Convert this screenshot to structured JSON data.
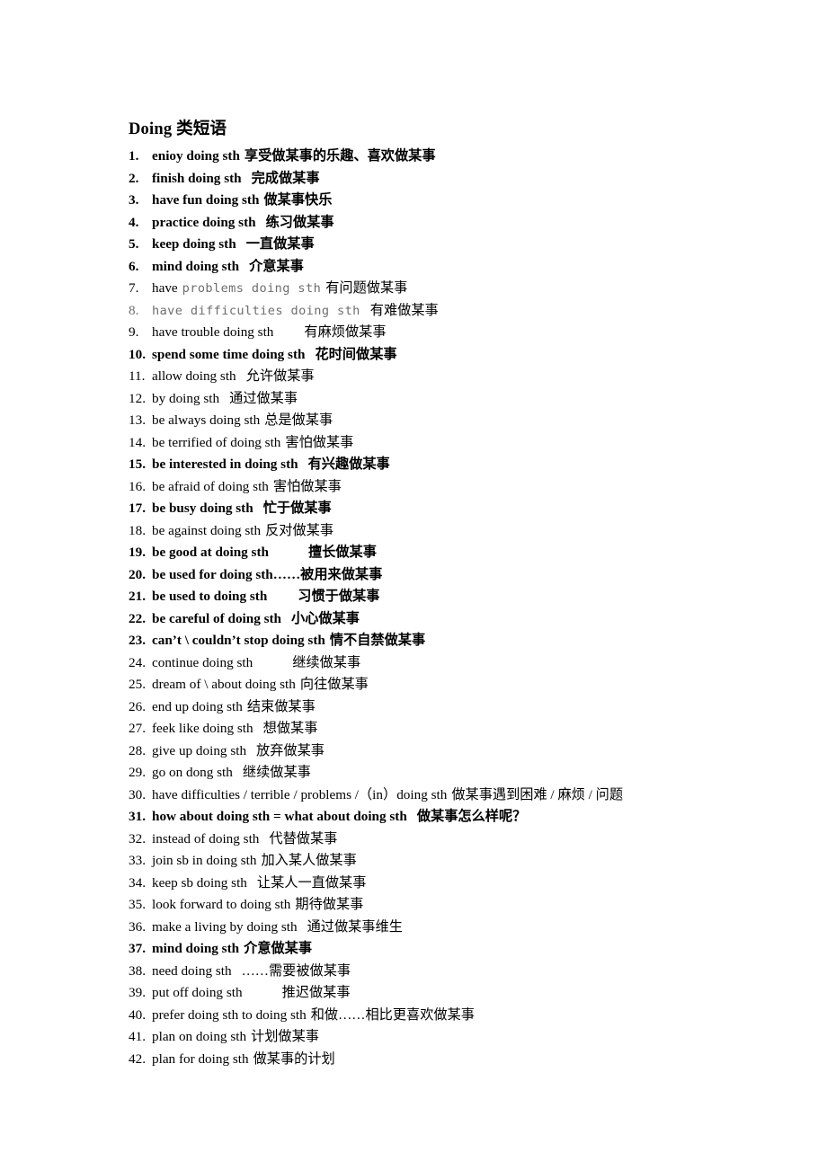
{
  "document": {
    "title": "Doing 类短语",
    "background_color": "#ffffff",
    "text_color": "#000000",
    "muted_text_color": "#6e6e6e"
  },
  "items": [
    {
      "num": "1.",
      "en": "enioy doing sth",
      "cn": "享受做某事的乐趣、喜欢做某事",
      "bold": true,
      "style": "normal",
      "gap": "sp1"
    },
    {
      "num": "2.",
      "en": "finish doing sth",
      "cn": "完成做某事",
      "bold": true,
      "style": "normal",
      "gap": "sp2"
    },
    {
      "num": "3.",
      "en": "have fun doing sth",
      "cn": "做某事快乐",
      "bold": true,
      "style": "normal",
      "gap": "sp1"
    },
    {
      "num": "4.",
      "en": "practice doing sth",
      "cn": "练习做某事",
      "bold": true,
      "style": "normal",
      "gap": "sp2"
    },
    {
      "num": "5.",
      "en": "keep doing sth",
      "cn": "一直做某事",
      "bold": true,
      "style": "normal",
      "gap": "sp2"
    },
    {
      "num": "6.",
      "en": "mind doing sth",
      "cn": "介意某事",
      "bold": true,
      "style": "normal",
      "gap": "sp2"
    },
    {
      "num": "7.",
      "en": "have",
      "en_mono": "problems doing sth",
      "cn": "有问题做某事",
      "bold": false,
      "style": "mixed-mono",
      "gap": "sp1"
    },
    {
      "num": "8.",
      "en_mono": "have difficulties doing sth",
      "cn": "有难做某事",
      "bold": false,
      "style": "all-gray-mono",
      "gap": "sp2"
    },
    {
      "num": "9.",
      "en": "have trouble doing sth",
      "cn": "有麻烦做某事",
      "bold": false,
      "style": "normal",
      "gap": "sp3"
    },
    {
      "num": "10.",
      "en": "spend some time doing sth",
      "cn": "花时间做某事",
      "bold": true,
      "style": "normal",
      "gap": "sp2"
    },
    {
      "num": "11.",
      "en": "allow doing sth",
      "cn": "允许做某事",
      "bold": false,
      "style": "normal",
      "gap": "sp2"
    },
    {
      "num": "12.",
      "en": "by doing sth",
      "cn": "通过做某事",
      "bold": false,
      "style": "normal",
      "gap": "sp2"
    },
    {
      "num": "13.",
      "en": "be always doing sth",
      "cn": "总是做某事",
      "bold": false,
      "style": "normal",
      "gap": "sp1"
    },
    {
      "num": "14.",
      "en": "be terrified of doing sth",
      "cn": "害怕做某事",
      "bold": false,
      "style": "normal",
      "gap": "sp1"
    },
    {
      "num": "15.",
      "en": "be interested in doing sth",
      "cn": "有兴趣做某事",
      "bold": true,
      "style": "normal",
      "gap": "sp2"
    },
    {
      "num": "16.",
      "en": "be afraid of doing sth",
      "cn": "害怕做某事",
      "bold": false,
      "style": "normal",
      "gap": "sp1"
    },
    {
      "num": "17.",
      "en": "be busy doing sth",
      "cn": "忙于做某事",
      "bold": true,
      "style": "normal",
      "gap": "sp2"
    },
    {
      "num": "18.",
      "en": "be against doing sth",
      "cn": "反对做某事",
      "bold": false,
      "style": "normal",
      "gap": "sp1"
    },
    {
      "num": "19.",
      "en": "be good at doing sth",
      "cn": "擅长做某事",
      "bold": true,
      "style": "normal",
      "gap": "sp4"
    },
    {
      "num": "20.",
      "en": "be used for doing sth",
      "cn": "……被用来做某事",
      "bold": true,
      "style": "normal",
      "gap": "none"
    },
    {
      "num": "21.",
      "en": "be used to doing sth",
      "cn": "习惯于做某事",
      "bold": true,
      "style": "normal",
      "gap": "sp3"
    },
    {
      "num": "22.",
      "en": "be careful of doing sth",
      "cn": "小心做某事",
      "bold": true,
      "style": "normal",
      "gap": "sp2"
    },
    {
      "num": "23.",
      "en": "can’t \\ couldn’t stop doing sth",
      "cn": "情不自禁做某事",
      "bold": true,
      "style": "normal",
      "gap": "sp1"
    },
    {
      "num": "24.",
      "en": "continue doing sth",
      "cn": "继续做某事",
      "bold": false,
      "style": "normal",
      "gap": "sp4"
    },
    {
      "num": "25.",
      "en": "dream of \\ about doing sth",
      "cn": "向往做某事",
      "bold": false,
      "style": "normal",
      "gap": "sp1"
    },
    {
      "num": "26.",
      "en": "end up doing sth",
      "cn": "结束做某事",
      "bold": false,
      "style": "normal",
      "gap": "sp1"
    },
    {
      "num": "27.",
      "en": "feek like doing sth",
      "cn": "想做某事",
      "bold": false,
      "style": "normal",
      "gap": "sp2"
    },
    {
      "num": "28.",
      "en": "give up doing sth",
      "cn": "放弃做某事",
      "bold": false,
      "style": "normal",
      "gap": "sp2"
    },
    {
      "num": "29.",
      "en": "go on dong sth",
      "cn": "继续做某事",
      "bold": false,
      "style": "normal",
      "gap": "sp2"
    },
    {
      "num": "30.",
      "en": "have difficulties / terrible / problems /（in）doing sth",
      "cn": "做某事遇到困难 / 麻烦 / 问题",
      "bold": false,
      "style": "normal",
      "gap": "sp1"
    },
    {
      "num": "31.",
      "en": "how about doing sth = what about doing sth",
      "cn": "做某事怎么样呢？",
      "bold": true,
      "style": "normal",
      "gap": "sp2"
    },
    {
      "num": "32.",
      "en": "instead of doing sth",
      "cn": "代替做某事",
      "bold": false,
      "style": "normal",
      "gap": "sp2"
    },
    {
      "num": "33.",
      "en": "join sb in doing sth",
      "cn": "加入某人做某事",
      "bold": false,
      "style": "normal",
      "gap": "sp1"
    },
    {
      "num": "34.",
      "en": "keep sb doing sth",
      "cn": "让某人一直做某事",
      "bold": false,
      "style": "normal",
      "gap": "sp2"
    },
    {
      "num": "35.",
      "en": "look forward to doing sth",
      "cn": "期待做某事",
      "bold": false,
      "style": "normal",
      "gap": "sp1"
    },
    {
      "num": "36.",
      "en": "make a living by doing sth",
      "cn": "通过做某事维生",
      "bold": false,
      "style": "normal",
      "gap": "sp2"
    },
    {
      "num": "37.",
      "en": "mind doing sth",
      "cn": "介意做某事",
      "bold": true,
      "style": "normal",
      "gap": "sp1"
    },
    {
      "num": "38.",
      "en": "need doing sth",
      "cn": "……需要被做某事",
      "bold": false,
      "style": "normal",
      "gap": "sp2"
    },
    {
      "num": "39.",
      "en": "put off doing sth",
      "cn": "推迟做某事",
      "bold": false,
      "style": "normal",
      "gap": "sp4"
    },
    {
      "num": "40.",
      "en": "prefer doing sth to doing sth",
      "cn": "和做……相比更喜欢做某事",
      "bold": false,
      "style": "normal",
      "gap": "sp1"
    },
    {
      "num": "41.",
      "en": "plan on doing sth",
      "cn": "计划做某事",
      "bold": false,
      "style": "normal",
      "gap": "sp1"
    },
    {
      "num": "42.",
      "en": "plan for doing sth",
      "cn": "做某事的计划",
      "bold": false,
      "style": "normal",
      "gap": "sp1"
    }
  ]
}
